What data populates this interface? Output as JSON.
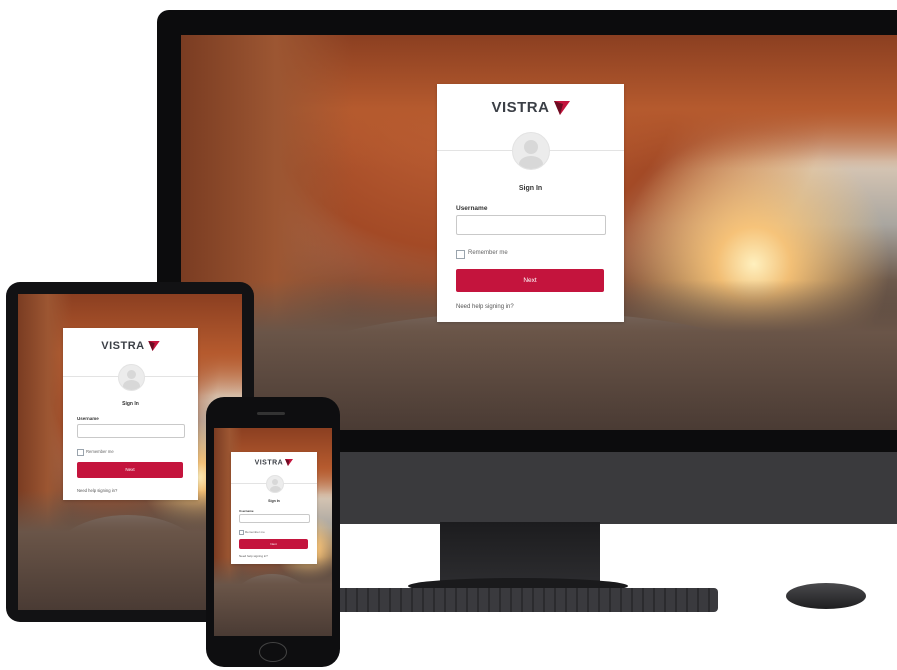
{
  "brand": {
    "name": "VISTRA",
    "logo_color": "#c4143d"
  },
  "login": {
    "title": "Sign In",
    "username_label": "Username",
    "username_value": "",
    "remember_label": "Remember me",
    "next_label": "Next",
    "help_link": "Need help signing in?"
  },
  "colors": {
    "accent": "#c4143d",
    "card_bg": "#ffffff",
    "device_frame": "#0c0c0d"
  },
  "devices": [
    "desktop-monitor",
    "tablet",
    "smartphone"
  ]
}
